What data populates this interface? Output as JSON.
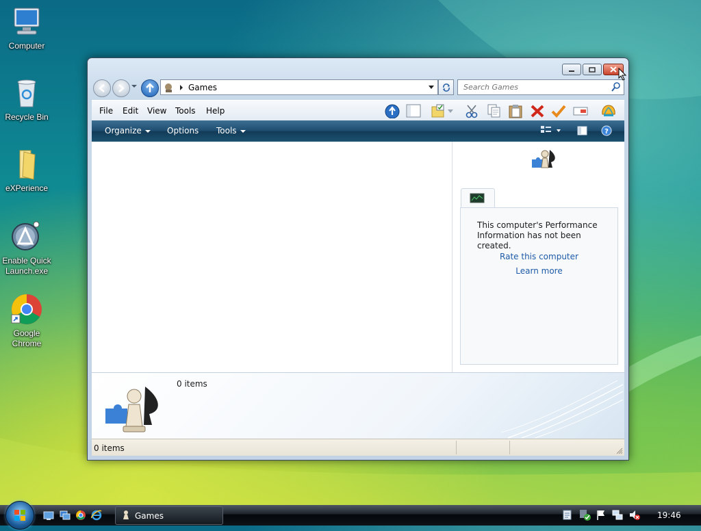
{
  "desktop": {
    "icons": [
      {
        "label": "Computer"
      },
      {
        "label": "Recycle Bin"
      },
      {
        "label": "eXPerience"
      },
      {
        "label": "Enable Quick Launch.exe"
      },
      {
        "label": "Google Chrome"
      }
    ]
  },
  "window": {
    "address": {
      "location": "Games"
    },
    "search": {
      "placeholder": "Search Games"
    },
    "menubar": {
      "file": "File",
      "edit": "Edit",
      "view": "View",
      "tools": "Tools",
      "help": "Help"
    },
    "commandbar": {
      "organize": "Organize",
      "options": "Options",
      "tools": "Tools"
    },
    "sidepane": {
      "performance_message": "This computer's Performance Information has not been created.",
      "rate_link": "Rate this computer",
      "learn_link": "Learn more"
    },
    "details": {
      "item_count": "0 items"
    },
    "status": {
      "item_count": "0 items"
    }
  },
  "taskbar": {
    "task_label": "Games",
    "clock": "19:46"
  }
}
